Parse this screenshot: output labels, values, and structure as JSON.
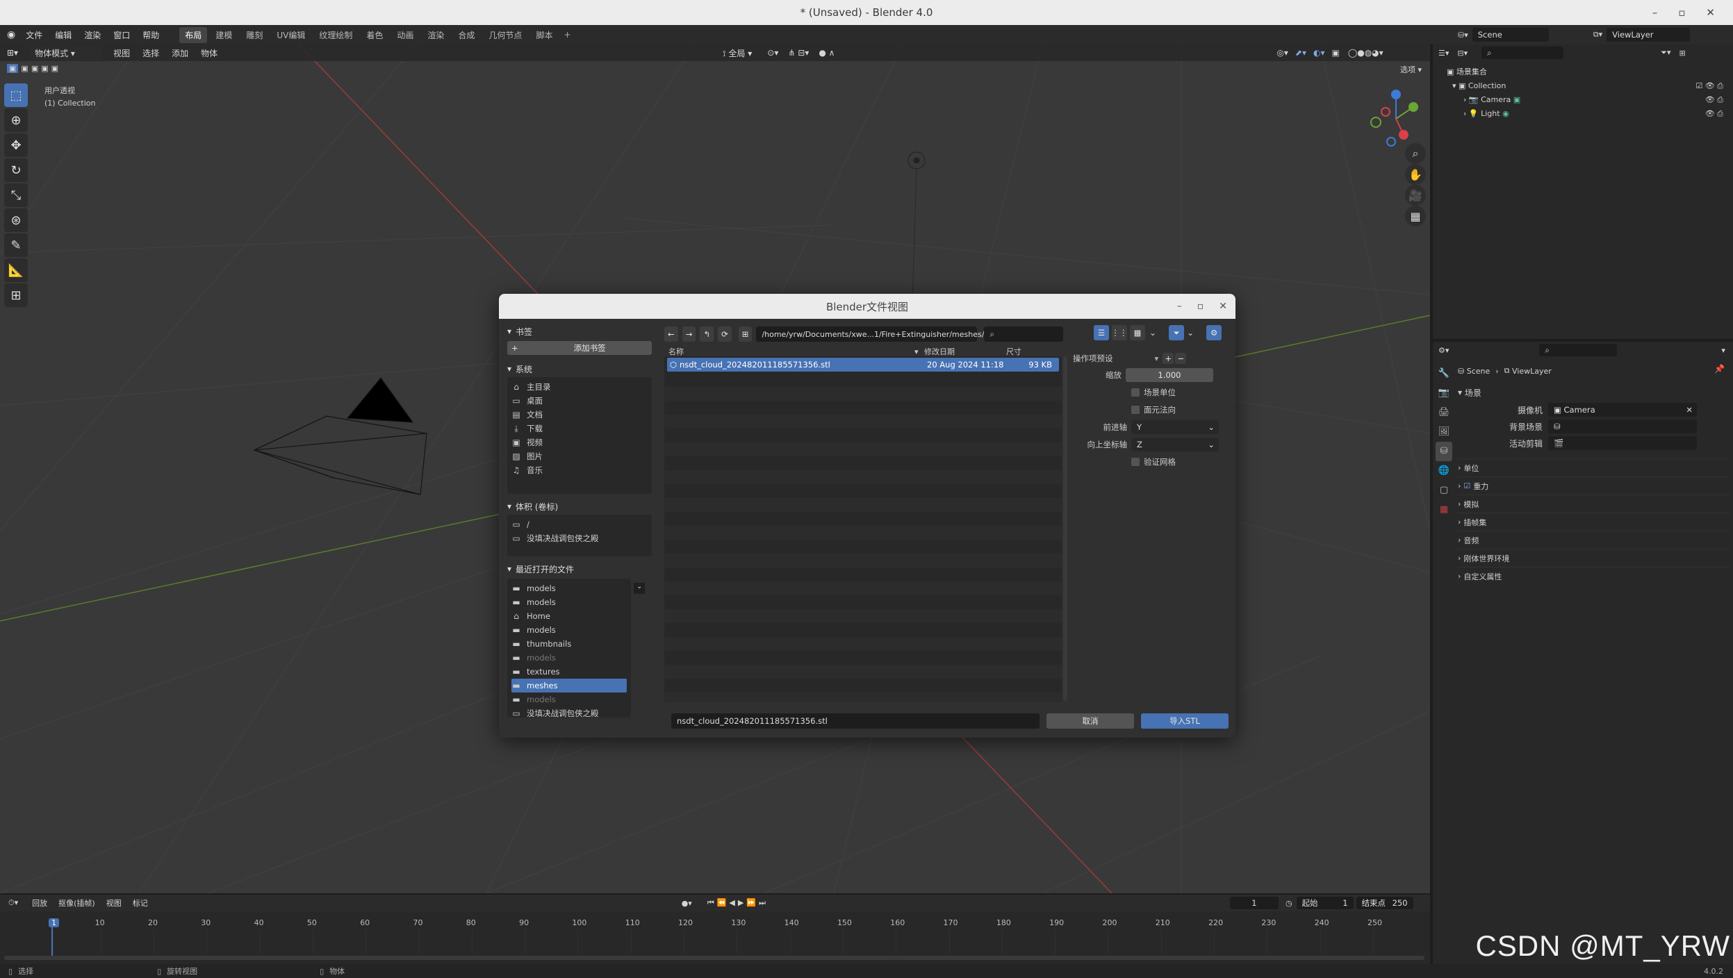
{
  "window": {
    "title": "* (Unsaved) - Blender 4.0",
    "minimize": "–",
    "maximize": "▫",
    "close": "✕"
  },
  "menu": [
    "文件",
    "编辑",
    "渲染",
    "窗口",
    "帮助"
  ],
  "workspaces": [
    {
      "label": "布局",
      "active": true
    },
    {
      "label": "建模",
      "active": false
    },
    {
      "label": "雕刻",
      "active": false
    },
    {
      "label": "UV编辑",
      "active": false
    },
    {
      "label": "纹理绘制",
      "active": false
    },
    {
      "label": "着色",
      "active": false
    },
    {
      "label": "动画",
      "active": false
    },
    {
      "label": "渲染",
      "active": false
    },
    {
      "label": "合成",
      "active": false
    },
    {
      "label": "几何节点",
      "active": false
    },
    {
      "label": "脚本",
      "active": false
    }
  ],
  "add_workspace": "+",
  "viewport": {
    "mode": "物体模式",
    "menus": [
      "视图",
      "选择",
      "添加",
      "物体"
    ],
    "transform": "全局",
    "options": "选项",
    "view_name": "用户透视",
    "collection": "(1) Collection"
  },
  "outliner": {
    "scene_label": "Scene",
    "viewlayer_label": "ViewLayer",
    "root": "场景集合",
    "collection": "Collection",
    "items": [
      "Camera",
      "Light"
    ]
  },
  "properties": {
    "breadcrumb_scene": "Scene",
    "breadcrumb_viewlayer": "ViewLayer",
    "section_scene": "场景",
    "camera_label": "摄像机",
    "camera_value": "Camera",
    "bg_scene_label": "背景场景",
    "active_clip_label": "活动剪辑",
    "panels": [
      "单位",
      "重力",
      "模拟",
      "插帧集",
      "音频",
      "刚体世界环境",
      "自定义属性"
    ]
  },
  "dialog": {
    "title": "Blender文件视图",
    "bookmarks_head": "书签",
    "add_bookmark": "添加书签",
    "system_head": "系统",
    "system_items": [
      {
        "icon": "home",
        "label": "主目录"
      },
      {
        "icon": "desktop",
        "label": "桌面"
      },
      {
        "icon": "doc",
        "label": "文档"
      },
      {
        "icon": "download",
        "label": "下载"
      },
      {
        "icon": "video",
        "label": "视频"
      },
      {
        "icon": "image",
        "label": "图片"
      },
      {
        "icon": "music",
        "label": "音乐"
      }
    ],
    "volumes_head": "体积 (卷标)",
    "volumes": [
      "/",
      "没填决战调包侠之殿"
    ],
    "recent_head": "最近打开的文件",
    "recent": [
      {
        "label": "models",
        "sel": false,
        "dim": false,
        "icon": "folder"
      },
      {
        "label": "models",
        "sel": false,
        "dim": false,
        "icon": "folder"
      },
      {
        "label": "Home",
        "sel": false,
        "dim": false,
        "icon": "home"
      },
      {
        "label": "models",
        "sel": false,
        "dim": false,
        "icon": "folder"
      },
      {
        "label": "thumbnails",
        "sel": false,
        "dim": false,
        "icon": "folder"
      },
      {
        "label": "models",
        "sel": false,
        "dim": true,
        "icon": "folder"
      },
      {
        "label": "textures",
        "sel": false,
        "dim": false,
        "icon": "folder"
      },
      {
        "label": "meshes",
        "sel": true,
        "dim": false,
        "icon": "folder"
      },
      {
        "label": "models",
        "sel": false,
        "dim": true,
        "icon": "folder"
      },
      {
        "label": "没填决战调包侠之殿",
        "sel": false,
        "dim": false,
        "icon": "drive"
      }
    ],
    "path": "/home/yrw/Documents/xwe...1/Fire+Extinguisher/meshes/",
    "col_name": "名称",
    "col_date": "修改日期",
    "col_size": "尺寸",
    "file": {
      "name": "nsdt_cloud_202482011185571356.stl",
      "date": "20 Aug 2024 11:18",
      "size": "93 KB"
    },
    "filename_value": "nsdt_cloud_202482011185571356.stl",
    "cancel": "取消",
    "import": "导入STL",
    "preset_label": "操作项预设",
    "scale_label": "缩放",
    "scale_value": "1.000",
    "scene_unit": "场景单位",
    "face_normal": "面元法向",
    "forward_label": "前进轴",
    "forward_value": "Y",
    "up_label": "向上坐标轴",
    "up_value": "Z",
    "validate": "验证网格"
  },
  "timeline": {
    "menus": [
      "回放",
      "抠像(插帧)",
      "视图",
      "标记"
    ],
    "current": "1",
    "start_label": "起始",
    "start": "1",
    "end_label": "结束点",
    "end": "250",
    "ticks": [
      "1",
      "10",
      "20",
      "30",
      "40",
      "50",
      "60",
      "70",
      "80",
      "90",
      "100",
      "110",
      "120",
      "130",
      "140",
      "150",
      "160",
      "170",
      "180",
      "190",
      "200",
      "210",
      "220",
      "230",
      "240",
      "250"
    ]
  },
  "status": {
    "select": "选择",
    "rotate": "旋转视图",
    "object": "物体",
    "version": "4.0.2"
  },
  "watermark": "CSDN @MT_YRW",
  "colors": {
    "accent": "#4772b3",
    "bg": "#393939",
    "panel": "#282828"
  }
}
